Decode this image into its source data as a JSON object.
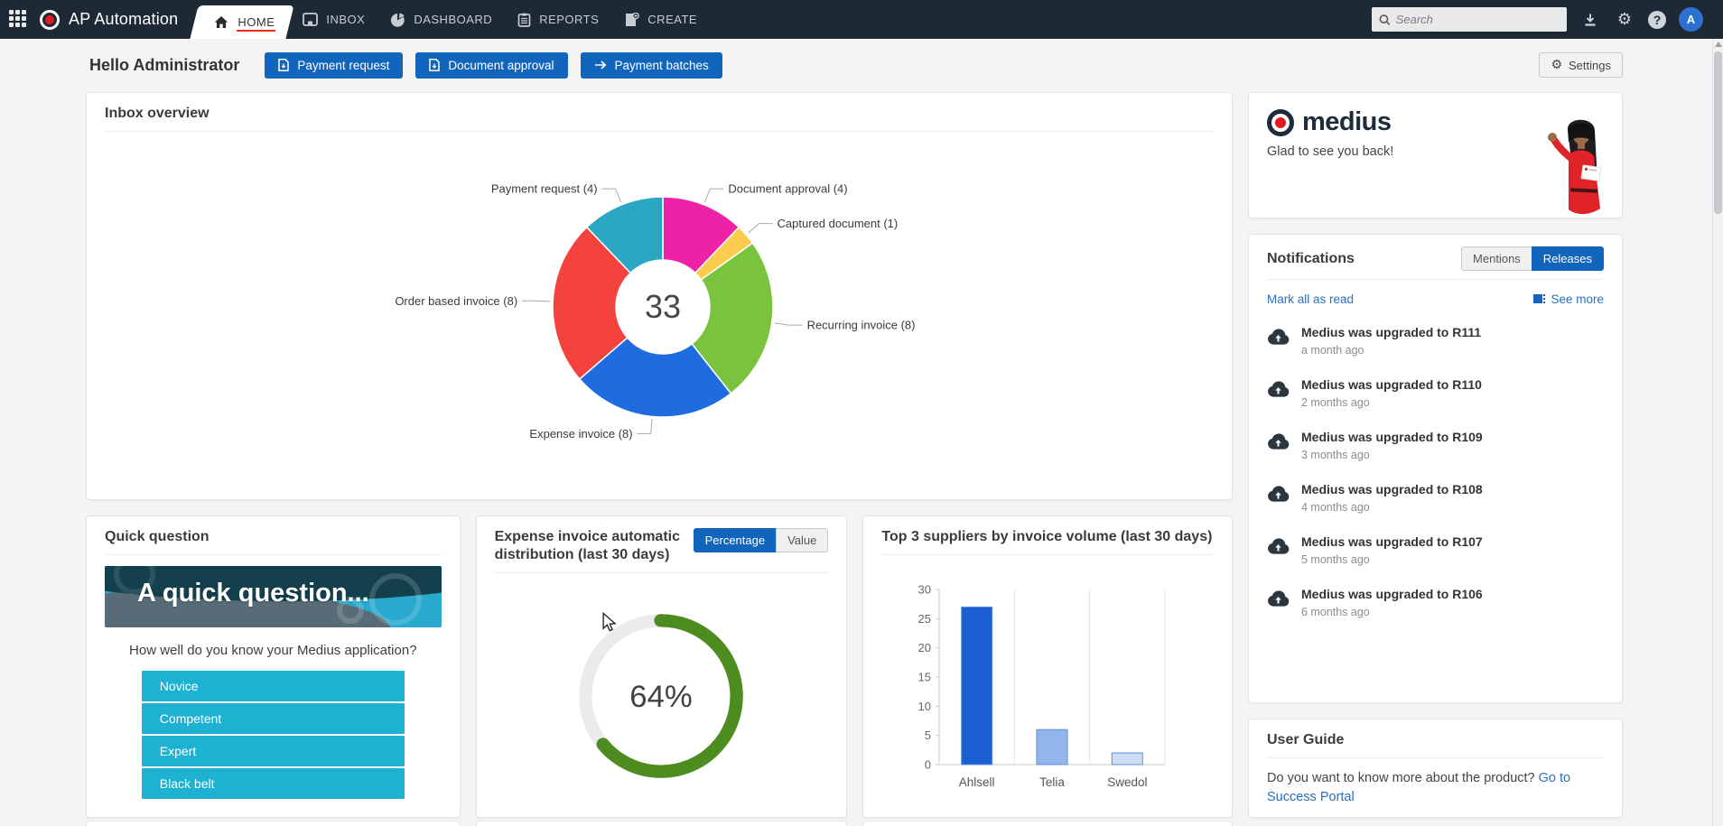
{
  "navbar": {
    "app_title": "AP Automation",
    "tabs": [
      {
        "label": "HOME",
        "icon": "home-icon",
        "active": true
      },
      {
        "label": "INBOX",
        "icon": "inbox-icon",
        "active": false
      },
      {
        "label": "DASHBOARD",
        "icon": "dashboard-icon",
        "active": false
      },
      {
        "label": "REPORTS",
        "icon": "reports-icon",
        "active": false
      },
      {
        "label": "CREATE",
        "icon": "create-icon",
        "active": false
      }
    ],
    "search": {
      "placeholder": "Search"
    },
    "avatar_initial": "A"
  },
  "header": {
    "greeting": "Hello Administrator",
    "buttons": [
      {
        "label": "Payment request",
        "icon": "document-icon"
      },
      {
        "label": "Document approval",
        "icon": "document-icon"
      },
      {
        "label": "Payment batches",
        "icon": "arrow-right-icon"
      }
    ],
    "settings_label": "Settings"
  },
  "cards": {
    "inbox_overview": {
      "title": "Inbox overview"
    },
    "quick_question": {
      "title": "Quick question",
      "banner_text": "A quick question...",
      "question": "How well do you know your Medius application?",
      "options": [
        "Novice",
        "Competent",
        "Expert",
        "Black belt"
      ]
    },
    "expense_distribution": {
      "title": "Expense invoice automatic distribution (last 30 days)",
      "toggle": {
        "options": [
          "Percentage",
          "Value"
        ],
        "active": "Percentage"
      },
      "value_display": "64%"
    },
    "top_suppliers": {
      "title": "Top 3 suppliers by invoice volume (last 30 days)"
    },
    "medius_welcome": {
      "brand": "medius",
      "message": "Glad to see you back!"
    },
    "notifications": {
      "title": "Notifications",
      "tabs": {
        "options": [
          "Mentions",
          "Releases"
        ],
        "active": "Releases"
      },
      "mark_all_label": "Mark all as read",
      "see_more_label": "See more",
      "items": [
        {
          "title": "Medius was upgraded to R111",
          "time": "a month ago"
        },
        {
          "title": "Medius was upgraded to R110",
          "time": "2 months ago"
        },
        {
          "title": "Medius was upgraded to R109",
          "time": "3 months ago"
        },
        {
          "title": "Medius was upgraded to R108",
          "time": "4 months ago"
        },
        {
          "title": "Medius was upgraded to R107",
          "time": "5 months ago"
        },
        {
          "title": "Medius was upgraded to R106",
          "time": "6 months ago"
        }
      ]
    },
    "user_guide": {
      "title": "User Guide",
      "text": "Do you want to know more about the product?",
      "link_label": "Go to Success Portal"
    }
  },
  "chart_data": [
    {
      "id": "inbox-donut",
      "type": "pie",
      "subtype": "donut",
      "title": "Inbox overview",
      "center_total": "33",
      "start": "12-oclock-clockwise",
      "slices": [
        {
          "label": "Document approval (4)",
          "value": 4,
          "color": "#ed22a6"
        },
        {
          "label": "Captured document (1)",
          "value": 1,
          "color": "#fbcc4e"
        },
        {
          "label": "Recurring invoice (8)",
          "value": 8,
          "color": "#7ac33f"
        },
        {
          "label": "Expense invoice (8)",
          "value": 8,
          "color": "#1f6ce0"
        },
        {
          "label": "Order based invoice (8)",
          "value": 8,
          "color": "#f4423c"
        },
        {
          "label": "Payment request (4)",
          "value": 4,
          "color": "#2ba7c4"
        }
      ]
    },
    {
      "id": "automation-gauge",
      "type": "pie",
      "subtype": "progress-ring",
      "title": "Expense invoice automatic distribution (last 30 days)",
      "value": 64,
      "label": "64%",
      "color": "#4d8c1e",
      "track_color": "#ebebeb"
    },
    {
      "id": "suppliers-bar",
      "type": "bar",
      "title": "Top 3 suppliers by invoice volume (last 30 days)",
      "categories": [
        "Ahlsell",
        "Telia",
        "Swedol"
      ],
      "values": [
        27,
        6,
        2
      ],
      "colors": [
        "#1b5fd3",
        "#92b6eb",
        "#cddcf7"
      ],
      "ylim": [
        0,
        30
      ],
      "yticks": [
        0,
        5,
        10,
        15,
        20,
        25,
        30
      ],
      "grid": "vertical"
    }
  ],
  "colors": {
    "navbar_bg": "#1d2935",
    "accent_blue": "#1165bd",
    "link_blue": "#2a6fc0",
    "active_tab_underline": "#e0301e",
    "teal_button": "#1db1d2",
    "brand_red": "#e11b22"
  }
}
